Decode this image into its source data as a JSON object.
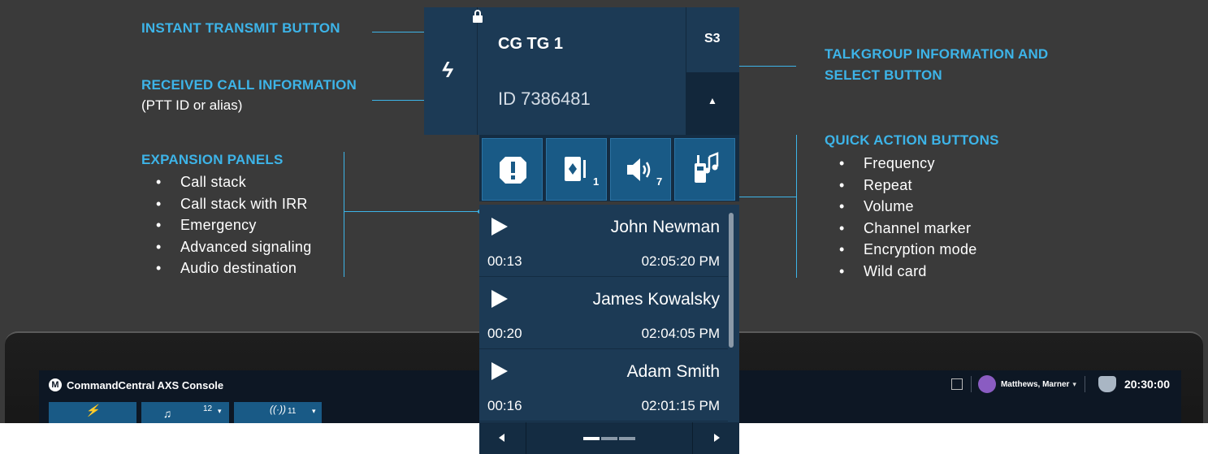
{
  "callouts": {
    "instant_transmit": "INSTANT TRANSMIT BUTTON",
    "received_call": "RECEIVED CALL INFORMATION",
    "received_call_sub": "(PTT ID or alias)",
    "expansion_panels": {
      "title": "EXPANSION PANELS",
      "items": [
        "Call stack",
        "Call stack with IRR",
        "Emergency",
        "Advanced signaling",
        "Audio destination"
      ]
    },
    "talkgroup_line1": "TALKGROUP INFORMATION AND",
    "talkgroup_line2": "SELECT BUTTON",
    "quick_actions": {
      "title": "QUICK ACTION BUTTONS",
      "items": [
        "Frequency",
        "Repeat",
        "Volume",
        "Channel marker",
        "Encryption mode",
        "Wild card"
      ]
    }
  },
  "widget": {
    "talkgroup_name": "CG TG 1",
    "received_id": "ID 7386481",
    "slot_label": "S3",
    "quick_buttons": [
      {
        "icon": "emergency-alert-icon"
      },
      {
        "icon": "call-stack-card-icon",
        "count": "1"
      },
      {
        "icon": "volume-icon",
        "count": "7"
      },
      {
        "icon": "radio-music-icon"
      }
    ],
    "calls": [
      {
        "name": "John Newman",
        "duration": "00:13",
        "time": "02:05:20 PM"
      },
      {
        "name": "James Kowalsky",
        "duration": "00:20",
        "time": "02:04:05 PM"
      },
      {
        "name": "Adam Smith",
        "duration": "00:16",
        "time": "02:01:15 PM"
      }
    ],
    "pager_active_page": 1
  },
  "console": {
    "app_title": "CommandCentral AXS Console",
    "tile_counts": [
      "12",
      "11"
    ],
    "user_name": "Matthews, Marner",
    "clock": "20:30:00"
  },
  "colors": {
    "accent": "#3db4e8",
    "widget_bg": "#1c3a55",
    "button_blue": "#195a86",
    "page_bg": "#3a3a3a"
  }
}
